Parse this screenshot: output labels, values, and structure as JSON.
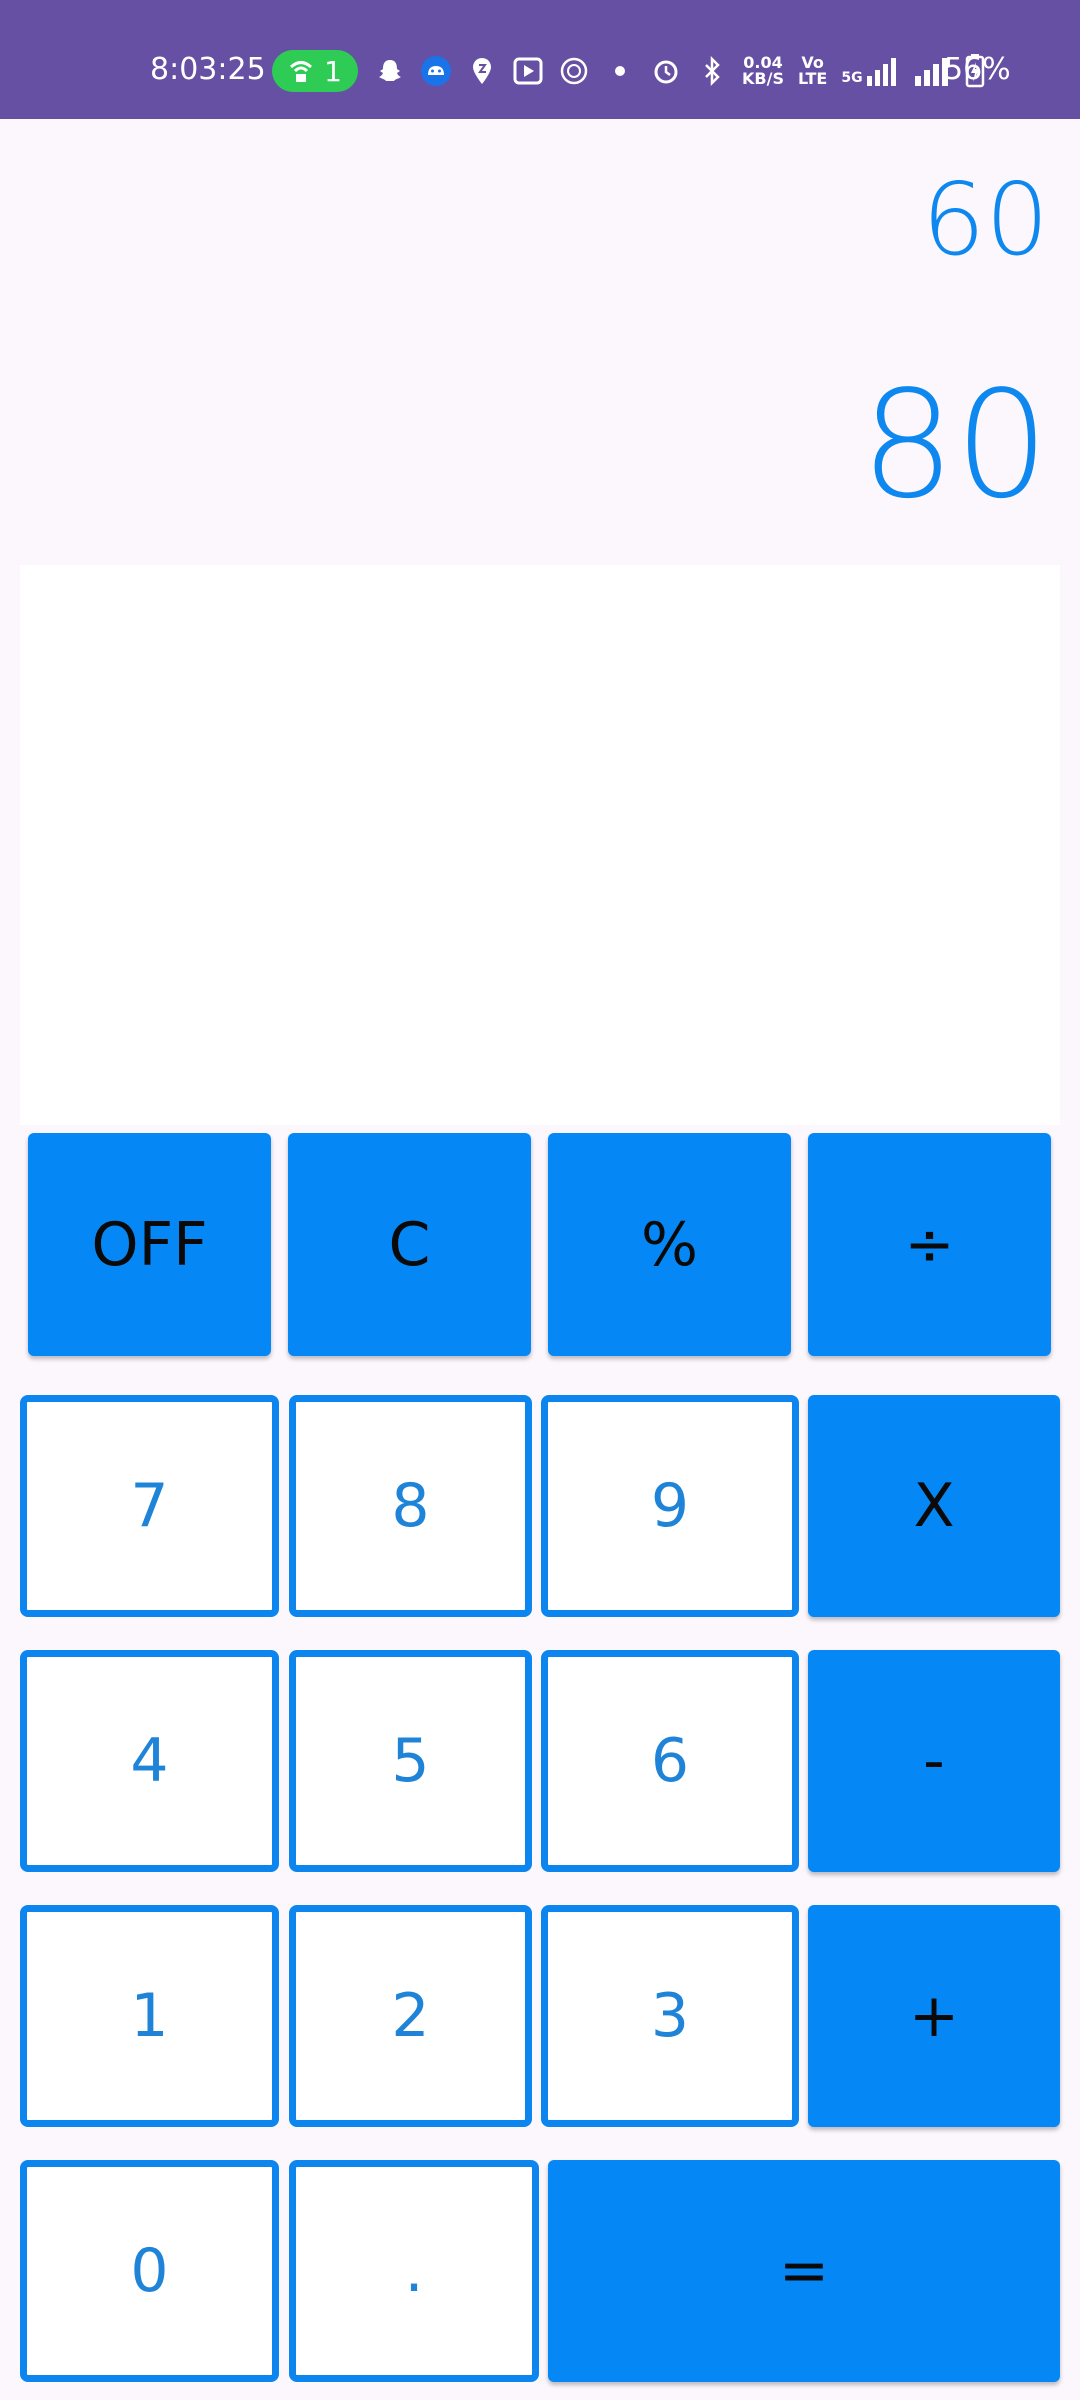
{
  "status_bar": {
    "time": "8:03:25",
    "hotspot_count": "1",
    "net_speed_top": "0.04",
    "net_speed_bottom": "KB/S",
    "volte_top": "Vo",
    "volte_bottom": "LTE",
    "network_label": "5G",
    "battery": "56%"
  },
  "display": {
    "previous": "60",
    "current": "80"
  },
  "keypad": {
    "off": "OFF",
    "clear": "C",
    "percent": "%",
    "divide": "÷",
    "seven": "7",
    "eight": "8",
    "nine": "9",
    "multiply": "X",
    "four": "4",
    "five": "5",
    "six": "6",
    "minus": "-",
    "one": "1",
    "two": "2",
    "three": "3",
    "plus": "+",
    "zero": "0",
    "dot": ".",
    "equals": "="
  },
  "colors": {
    "status_bar_bg": "#6650a4",
    "accent_blue": "#0588f6",
    "digit_text": "#1f84d8",
    "background": "#fcf6fd"
  }
}
